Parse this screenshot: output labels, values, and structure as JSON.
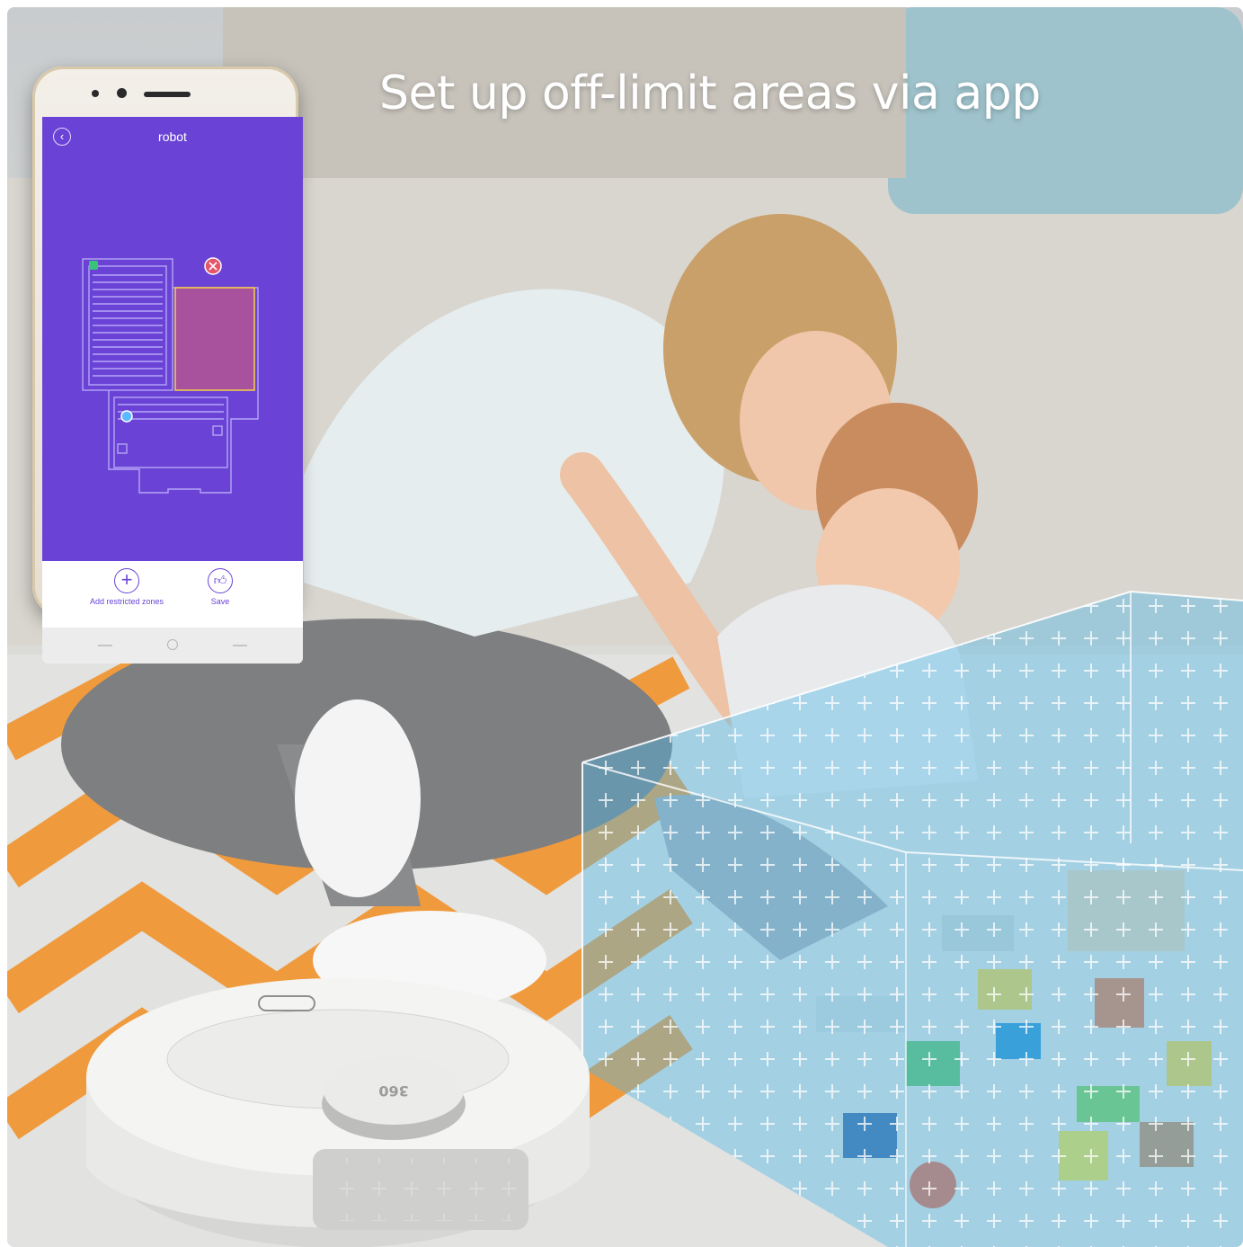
{
  "headline": "Set up off-limit areas via app",
  "phone": {
    "app_title": "robot",
    "back_icon": "chevron-left-icon",
    "actions": [
      {
        "label": "Add restricted zones",
        "icon": "plus-icon"
      },
      {
        "label": "Save",
        "icon": "thumbs-up-icon"
      }
    ]
  },
  "robot_logo": "360",
  "colors": {
    "app_purple": "#6a43d6",
    "restricted_zone": "#a8519d",
    "zone_outline": "#f2c94c",
    "barrier_blue": "#4fb7e6",
    "rug_orange": "#f09a3e"
  }
}
